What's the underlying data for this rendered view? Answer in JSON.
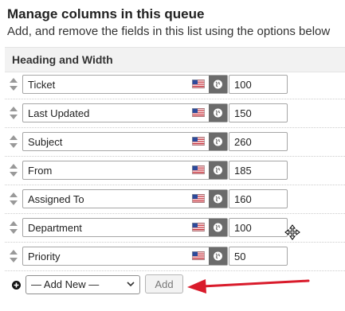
{
  "header": {
    "title": "Manage columns in this queue",
    "subtitle": "Add, and remove the fields in this list using the options below"
  },
  "section": {
    "title": "Heading and Width"
  },
  "columns": [
    {
      "name": "Ticket",
      "width": "100"
    },
    {
      "name": "Last Updated",
      "width": "150"
    },
    {
      "name": "Subject",
      "width": "260"
    },
    {
      "name": "From",
      "width": "185"
    },
    {
      "name": "Assigned To",
      "width": "160"
    },
    {
      "name": "Department",
      "width": "100"
    },
    {
      "name": "Priority",
      "width": "50"
    }
  ],
  "add_new": {
    "select_value": "— Add New —",
    "button_label": "Add"
  },
  "icons": {
    "drag": "drag-handle-icon",
    "flag": "us-flag-icon",
    "globe": "globe-icon",
    "add": "plus-circle-icon",
    "arrow": "red-arrow-icon",
    "cursor": "move-cursor-icon"
  },
  "colors": {
    "annotation_arrow": "#d91b2b",
    "globe_bg": "#6b6b6b",
    "section_bg": "#f2f2f2"
  }
}
